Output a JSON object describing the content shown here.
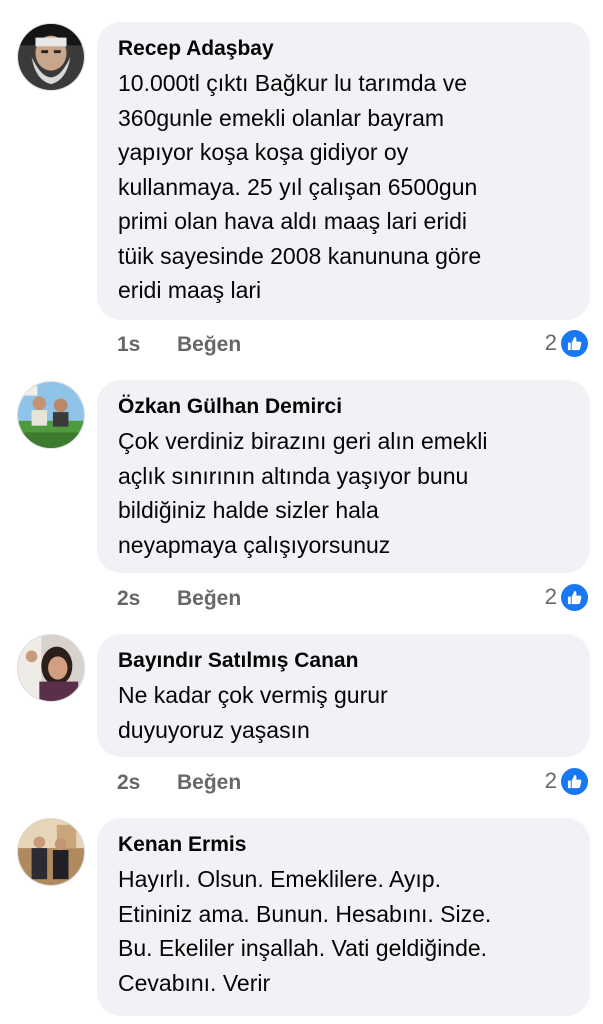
{
  "comments": [
    {
      "author": "Recep Adaşbay",
      "lines": [
        "10.000tl çıktı Bağkur lu tarımda ve",
        "360gunle emekli olanlar bayram",
        "yapıyor koşa koşa gidiyor oy",
        "kullanmaya. 25 yıl çalışan 6500gun",
        "primi olan hava aldı maaş lari eridi",
        "tüik sayesinde 2008 kanununa göre",
        "eridi maaş lari"
      ],
      "time": "1s",
      "like_label": "Beğen",
      "reaction_count": "2"
    },
    {
      "author": "Özkan Gülhan Demirci",
      "lines": [
        "Çok verdiniz birazını geri alın emekli",
        "açlık sınırının altında yaşıyor bunu",
        "bildiğiniz halde sizler hala",
        "neyapmaya çalışıyorsunuz"
      ],
      "time": "2s",
      "like_label": "Beğen",
      "reaction_count": "2"
    },
    {
      "author": "Bayındır Satılmış Canan",
      "lines": [
        "Ne kadar çok  vermiş  gurur",
        "duyuyoruz  yaşasın"
      ],
      "time": "2s",
      "like_label": "Beğen",
      "reaction_count": "2"
    },
    {
      "author": "Kenan Ermis",
      "lines": [
        "Hayırlı. Olsun. Emeklilere.  Ayıp.",
        "Etininiz ama. Bunun. Hesabını. Size.",
        "Bu. Ekeliler inşallah. Vati geldiğinde.",
        "Cevabını. Verir"
      ]
    }
  ],
  "icons": {
    "avatar": "profile-photo",
    "reaction": "like-thumbs-up-icon"
  },
  "colors": {
    "bubble": "#f0f2f5",
    "like_blue": "#1877f2",
    "meta_text": "#65676b",
    "primary_text": "#050505"
  }
}
